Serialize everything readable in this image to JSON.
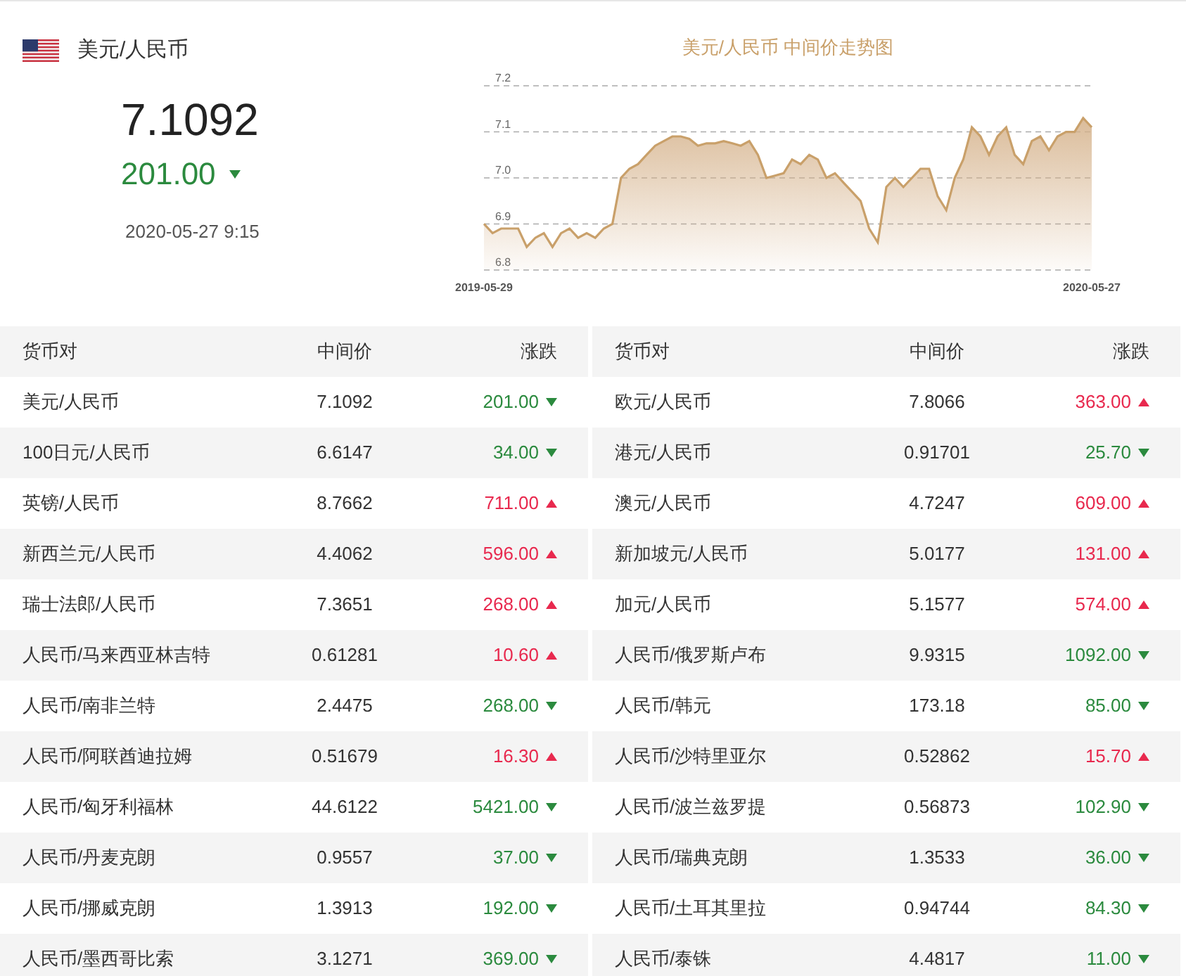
{
  "summary": {
    "pair": "美元/人民币",
    "mid_price": "7.1092",
    "change": "201.00",
    "kind": "down",
    "time": "2020-05-27 9:15"
  },
  "chart": {
    "chart_data": {
      "type": "area",
      "grid": true,
      "title": "美元/人民币 中间价走势图",
      "ylim": [
        6.8,
        7.2
      ],
      "yticks": [
        {
          "value": 6.8,
          "label": "6.8"
        },
        {
          "value": 6.9,
          "label": "6.9"
        },
        {
          "value": 7.0,
          "label": "7.0"
        },
        {
          "value": 7.1,
          "label": "7.1"
        },
        {
          "value": 7.2,
          "label": "7.2"
        }
      ],
      "categories": [
        "2019-05-29",
        null,
        null,
        null,
        null,
        null,
        null,
        null,
        null,
        null,
        null,
        null,
        null,
        null,
        null,
        null,
        null,
        null,
        null,
        null,
        null,
        null,
        null,
        null,
        null,
        null,
        null,
        null,
        null,
        null,
        null,
        null,
        null,
        null,
        null,
        null,
        null,
        null,
        null,
        null,
        null,
        null,
        null,
        null,
        null,
        null,
        null,
        null,
        null,
        null,
        null,
        null,
        null,
        null,
        null,
        null,
        null,
        null,
        null,
        null,
        null,
        null,
        null,
        null,
        null,
        null,
        null,
        null,
        null,
        null,
        null,
        "2020-05-27"
      ],
      "series": [
        {
          "color": "#c9a06a",
          "values": [
            6.9,
            6.88,
            6.89,
            6.89,
            6.89,
            6.85,
            6.87,
            6.88,
            6.85,
            6.88,
            6.89,
            6.87,
            6.88,
            6.87,
            6.89,
            6.9,
            7.0,
            7.02,
            7.03,
            7.05,
            7.07,
            7.08,
            7.09,
            7.09,
            7.085,
            7.07,
            7.075,
            7.075,
            7.08,
            7.075,
            7.07,
            7.08,
            7.05,
            7.0,
            7.005,
            7.01,
            7.04,
            7.03,
            7.05,
            7.04,
            7.0,
            7.01,
            6.99,
            6.97,
            6.95,
            6.89,
            6.86,
            6.98,
            7.0,
            6.98,
            7.0,
            7.02,
            7.02,
            6.96,
            6.93,
            7.0,
            7.04,
            7.11,
            7.09,
            7.05,
            7.09,
            7.11,
            7.05,
            7.03,
            7.08,
            7.09,
            7.06,
            7.09,
            7.1,
            7.1,
            7.13,
            7.11
          ]
        }
      ]
    }
  },
  "tables": [
    {
      "columns": [
        "货币对",
        "中间价",
        "涨跌"
      ],
      "rows": [
        {
          "pair": "美元/人民币",
          "mid_price": "7.1092",
          "change": "201.00",
          "kind": "down"
        },
        {
          "pair": "100日元/人民币",
          "mid_price": "6.6147",
          "change": "34.00",
          "kind": "down"
        },
        {
          "pair": "英镑/人民币",
          "mid_price": "8.7662",
          "change": "711.00",
          "kind": "up"
        },
        {
          "pair": "新西兰元/人民币",
          "mid_price": "4.4062",
          "change": "596.00",
          "kind": "up"
        },
        {
          "pair": "瑞士法郎/人民币",
          "mid_price": "7.3651",
          "change": "268.00",
          "kind": "up"
        },
        {
          "pair": "人民币/马来西亚林吉特",
          "mid_price": "0.61281",
          "change": "10.60",
          "kind": "up"
        },
        {
          "pair": "人民币/南非兰特",
          "mid_price": "2.4475",
          "change": "268.00",
          "kind": "down"
        },
        {
          "pair": "人民币/阿联酋迪拉姆",
          "mid_price": "0.51679",
          "change": "16.30",
          "kind": "up"
        },
        {
          "pair": "人民币/匈牙利福林",
          "mid_price": "44.6122",
          "change": "5421.00",
          "kind": "down"
        },
        {
          "pair": "人民币/丹麦克朗",
          "mid_price": "0.9557",
          "change": "37.00",
          "kind": "down"
        },
        {
          "pair": "人民币/挪威克朗",
          "mid_price": "1.3913",
          "change": "192.00",
          "kind": "down"
        },
        {
          "pair": "人民币/墨西哥比索",
          "mid_price": "3.1271",
          "change": "369.00",
          "kind": "down"
        }
      ]
    },
    {
      "columns": [
        "货币对",
        "中间价",
        "涨跌"
      ],
      "rows": [
        {
          "pair": "欧元/人民币",
          "mid_price": "7.8066",
          "change": "363.00",
          "kind": "up"
        },
        {
          "pair": "港元/人民币",
          "mid_price": "0.91701",
          "change": "25.70",
          "kind": "down"
        },
        {
          "pair": "澳元/人民币",
          "mid_price": "4.7247",
          "change": "609.00",
          "kind": "up"
        },
        {
          "pair": "新加坡元/人民币",
          "mid_price": "5.0177",
          "change": "131.00",
          "kind": "up"
        },
        {
          "pair": "加元/人民币",
          "mid_price": "5.1577",
          "change": "574.00",
          "kind": "up"
        },
        {
          "pair": "人民币/俄罗斯卢布",
          "mid_price": "9.9315",
          "change": "1092.00",
          "kind": "down"
        },
        {
          "pair": "人民币/韩元",
          "mid_price": "173.18",
          "change": "85.00",
          "kind": "down"
        },
        {
          "pair": "人民币/沙特里亚尔",
          "mid_price": "0.52862",
          "change": "15.70",
          "kind": "up"
        },
        {
          "pair": "人民币/波兰兹罗提",
          "mid_price": "0.56873",
          "change": "102.90",
          "kind": "down"
        },
        {
          "pair": "人民币/瑞典克朗",
          "mid_price": "1.3533",
          "change": "36.00",
          "kind": "down"
        },
        {
          "pair": "人民币/土耳其里拉",
          "mid_price": "0.94744",
          "change": "84.30",
          "kind": "down"
        },
        {
          "pair": "人民币/泰铢",
          "mid_price": "4.4817",
          "change": "11.00",
          "kind": "down"
        }
      ]
    }
  ]
}
